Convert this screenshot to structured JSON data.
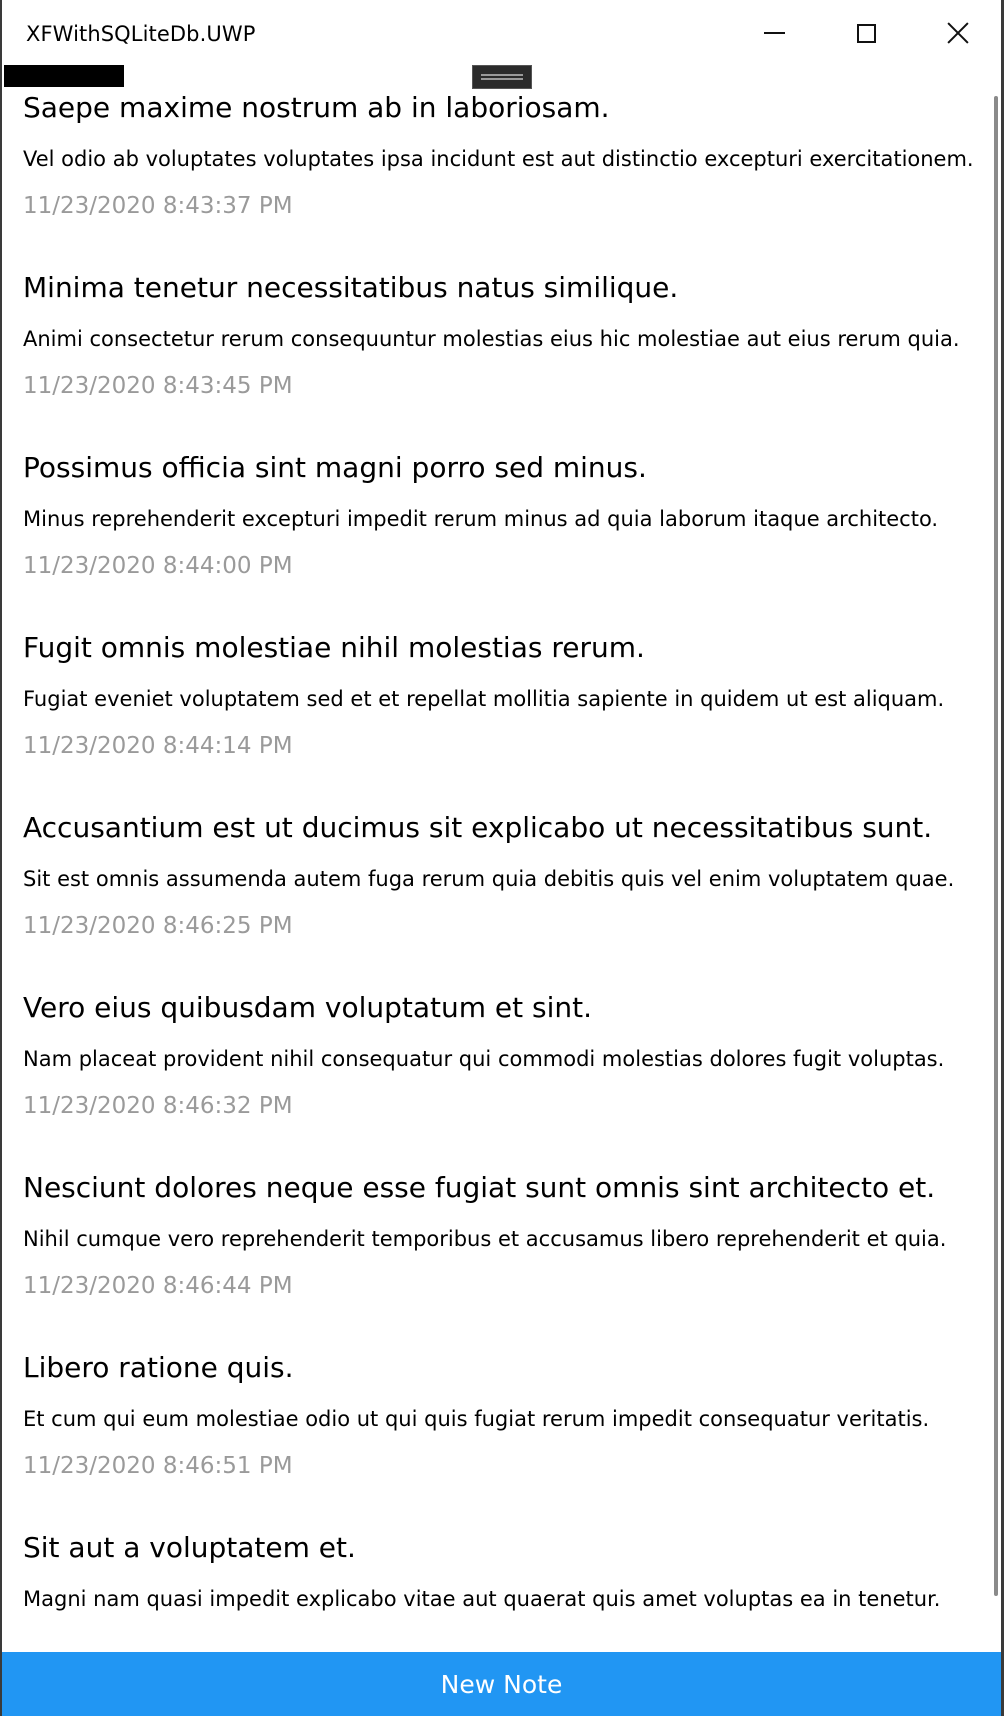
{
  "window": {
    "title": "XFWithSQLiteDb.UWP"
  },
  "notes": [
    {
      "title": "Saepe maxime nostrum ab in laboriosam.",
      "body": "Vel odio ab voluptates voluptates ipsa incidunt est aut distinctio excepturi exercitationem.",
      "date": "11/23/2020 8:43:37 PM"
    },
    {
      "title": "Minima tenetur necessitatibus natus similique.",
      "body": "Animi consectetur rerum consequuntur molestias eius hic molestiae aut eius rerum quia.",
      "date": "11/23/2020 8:43:45 PM"
    },
    {
      "title": "Possimus officia sint magni porro sed minus.",
      "body": "Minus reprehenderit excepturi impedit rerum minus ad quia laborum itaque architecto.",
      "date": "11/23/2020 8:44:00 PM"
    },
    {
      "title": "Fugit omnis molestiae nihil molestias rerum.",
      "body": "Fugiat eveniet voluptatem sed et et repellat mollitia sapiente in quidem ut est aliquam.",
      "date": "11/23/2020 8:44:14 PM"
    },
    {
      "title": "Accusantium est ut ducimus sit explicabo ut necessitatibus sunt.",
      "body": "Sit est omnis assumenda autem fuga rerum quia debitis quis vel enim voluptatem quae.",
      "date": "11/23/2020 8:46:25 PM"
    },
    {
      "title": "Vero eius quibusdam voluptatum et sint.",
      "body": "Nam placeat provident nihil consequatur qui commodi molestias dolores fugit voluptas.",
      "date": "11/23/2020 8:46:32 PM"
    },
    {
      "title": "Nesciunt dolores neque esse fugiat sunt omnis sint architecto et.",
      "body": "Nihil cumque vero reprehenderit temporibus et accusamus libero reprehenderit et quia.",
      "date": "11/23/2020 8:46:44 PM"
    },
    {
      "title": "Libero ratione quis.",
      "body": "Et cum qui eum molestiae odio ut qui quis fugiat rerum impedit consequatur veritatis.",
      "date": "11/23/2020 8:46:51 PM"
    },
    {
      "title": "Sit aut a voluptatem et.",
      "body": "Magni nam quasi impedit explicabo vitae aut quaerat quis amet voluptas ea in tenetur.",
      "date": ""
    }
  ],
  "footer": {
    "new_note_label": "New Note"
  },
  "colors": {
    "accent": "#2196f3",
    "date_text": "#9a9a9a"
  },
  "icons": {
    "minimize": "minimize-icon",
    "maximize": "maximize-icon",
    "close": "close-icon"
  }
}
